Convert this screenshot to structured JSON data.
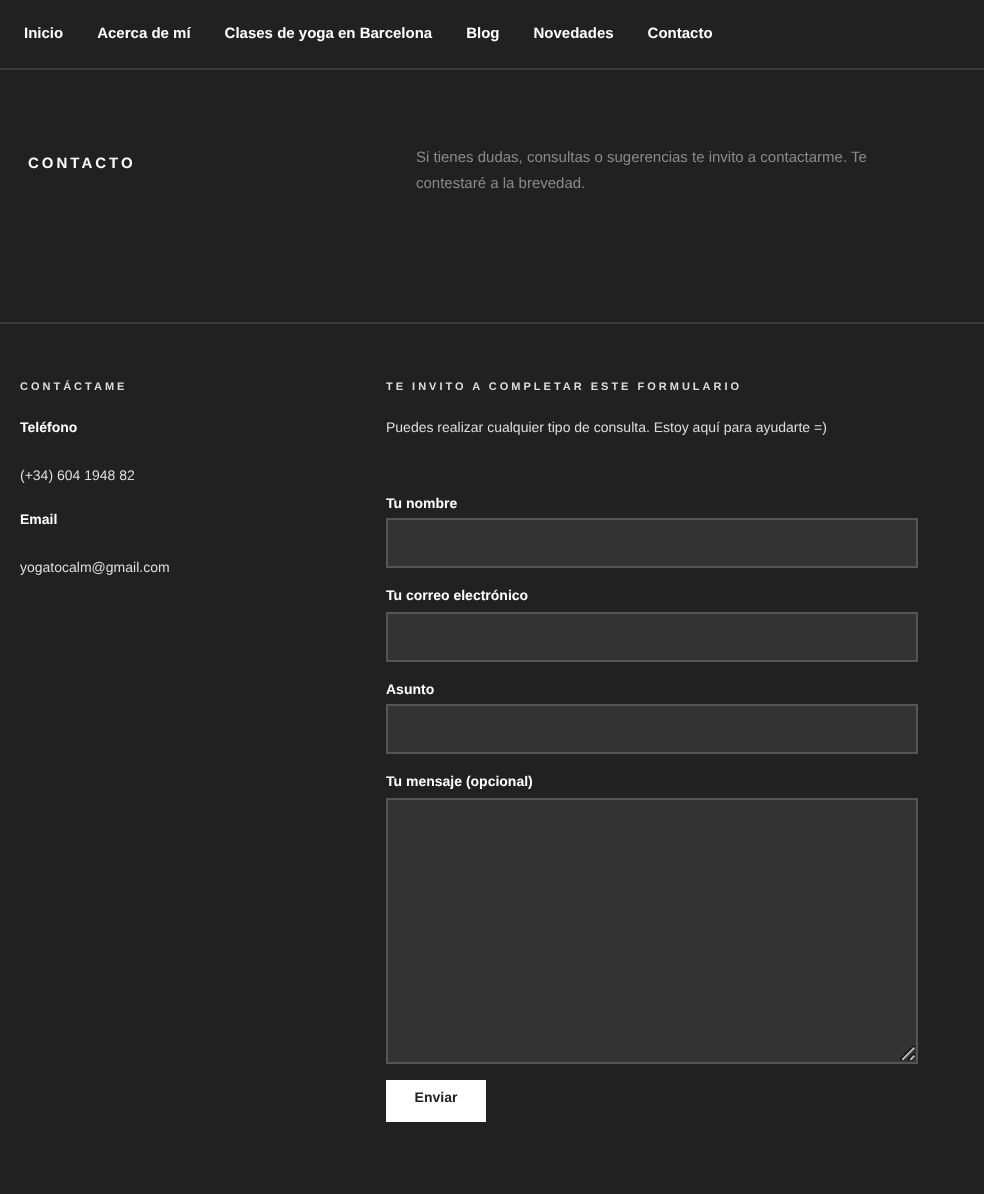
{
  "nav": [
    {
      "label": "Inicio"
    },
    {
      "label": "Acerca de mí"
    },
    {
      "label": "Clases de yoga en Barcelona"
    },
    {
      "label": "Blog"
    },
    {
      "label": "Novedades"
    },
    {
      "label": "Contacto"
    }
  ],
  "intro": {
    "title": "CONTACTO",
    "text": "Si tienes dudas, consultas o sugerencias te invito a contactarme. Te contestaré a la brevedad."
  },
  "contact": {
    "title": "CONTÁCTAME",
    "items": [
      {
        "label": "Teléfono",
        "value": "(+34) 604 1948 82"
      },
      {
        "label": "Email",
        "value": "yogatocalm@gmail.com"
      }
    ]
  },
  "form": {
    "title": "TE INVITO A COMPLETAR ESTE FORMULARIO",
    "text": "Puedes realizar cualquier tipo de consulta. Estoy aquí para ayudarte =)",
    "fields": [
      {
        "label": "Tu nombre",
        "kind": "input"
      },
      {
        "label": "Tu correo electrónico",
        "kind": "input"
      },
      {
        "label": "Asunto",
        "kind": "input"
      },
      {
        "label": "Tu mensaje (opcional)",
        "kind": "textarea"
      }
    ],
    "submit": "Enviar"
  }
}
